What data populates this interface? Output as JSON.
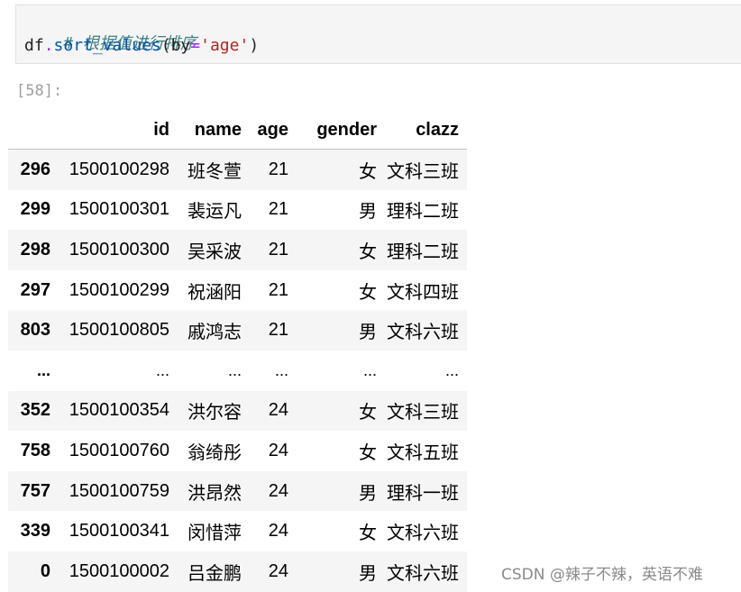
{
  "input_cell": {
    "comment": "# 根据值进行排序",
    "code": {
      "obj": "df",
      "dot": ".",
      "method": "sort_values",
      "open": "(",
      "kw": "by",
      "eq": "=",
      "arg": "'age'",
      "close": ")"
    }
  },
  "output": {
    "prompt": "[58]:",
    "table": {
      "columns": [
        "id",
        "name",
        "age",
        "gender",
        "clazz"
      ],
      "rows": [
        {
          "index": "296",
          "id": "1500100298",
          "name": "班冬萱",
          "age": "21",
          "gender": "女",
          "clazz": "文科三班"
        },
        {
          "index": "299",
          "id": "1500100301",
          "name": "裴运凡",
          "age": "21",
          "gender": "男",
          "clazz": "理科二班"
        },
        {
          "index": "298",
          "id": "1500100300",
          "name": "吴采波",
          "age": "21",
          "gender": "女",
          "clazz": "理科二班"
        },
        {
          "index": "297",
          "id": "1500100299",
          "name": "祝涵阳",
          "age": "21",
          "gender": "女",
          "clazz": "文科四班"
        },
        {
          "index": "803",
          "id": "1500100805",
          "name": "戚鸿志",
          "age": "21",
          "gender": "男",
          "clazz": "文科六班"
        },
        {
          "index": "...",
          "id": "...",
          "name": "...",
          "age": "...",
          "gender": "...",
          "clazz": "..."
        },
        {
          "index": "352",
          "id": "1500100354",
          "name": "洪尔容",
          "age": "24",
          "gender": "女",
          "clazz": "文科三班"
        },
        {
          "index": "758",
          "id": "1500100760",
          "name": "翁绮彤",
          "age": "24",
          "gender": "女",
          "clazz": "文科五班"
        },
        {
          "index": "757",
          "id": "1500100759",
          "name": "洪昂然",
          "age": "24",
          "gender": "男",
          "clazz": "理科一班"
        },
        {
          "index": "339",
          "id": "1500100341",
          "name": "闵惜萍",
          "age": "24",
          "gender": "女",
          "clazz": "文科六班"
        },
        {
          "index": "0",
          "id": "1500100002",
          "name": "吕金鹏",
          "age": "24",
          "gender": "男",
          "clazz": "文科六班"
        }
      ]
    }
  },
  "watermark": "CSDN @辣子不辣，英语不难"
}
